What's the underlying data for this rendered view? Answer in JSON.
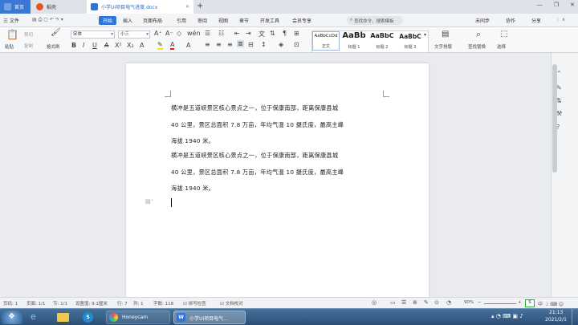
{
  "tabs": {
    "home": "首页",
    "straw": "稻壳",
    "doc": "小学UI项目电气进度.docx",
    "plus": "+"
  },
  "window": {
    "minimize": "—",
    "restore": "❐",
    "close": "✕"
  },
  "menu": {
    "file": "三 文件",
    "items": [
      "开始",
      "插入",
      "页面布局",
      "引用",
      "审阅",
      "视图",
      "章节",
      "开发工具",
      "会员专享"
    ],
    "active_index": 0,
    "search": "查找命令、搜索模板",
    "right": [
      "未同步",
      "协作",
      "分享"
    ]
  },
  "ribbon": {
    "paste": "粘贴",
    "cut": "剪切",
    "copy": "复制",
    "format_painter": "格式刷",
    "font_name": "宋体",
    "font_size": "小三",
    "styles": [
      {
        "sample": "AaBbCcDd",
        "label": "正文"
      },
      {
        "sample": "AaBb",
        "label": "标题 1"
      },
      {
        "sample": "AaBbC",
        "label": "标题 2"
      },
      {
        "sample": "AaBbC",
        "label": "标题 3"
      }
    ],
    "text_layout": "文字排版",
    "find_replace": "查找替换",
    "select": "选择"
  },
  "document": {
    "paragraph1_lines": [
      "横冲是五道峡景区核心景点之一，位于保康南部，距离保康县城",
      "40 公里，景区总面积 7.8 万亩，年均气温 10 摄氏度，最高主峰",
      "海拔 1940 米。"
    ],
    "paragraph2_lines": [
      "横冲是五道峡景区核心景点之一，位于保康南部，距离保康县城",
      "40 公里，景区总面积 7.8 万亩，年均气温 10 摄氏度，最高主峰",
      "海拔 1940 米。"
    ]
  },
  "status": {
    "page_no": "页码: 1",
    "pages": "页面: 1/1",
    "section": "节: 1/1",
    "setting": "设置值: 9.1厘米",
    "row": "行: 7",
    "col": "列: 1",
    "words": "字数: 118",
    "spell": "拼写检查",
    "doc_check": "文档校对",
    "zoom": "90%",
    "zoom_minus": "−",
    "zoom_plus": "+"
  },
  "taskbar": {
    "honeycam": "Honeycam",
    "wps": "小学UI项目电气...",
    "time": "21:13",
    "date": "2021/2/1"
  },
  "colors": {
    "accent": "#2e74d9",
    "taskbar": "#2b4f76"
  }
}
